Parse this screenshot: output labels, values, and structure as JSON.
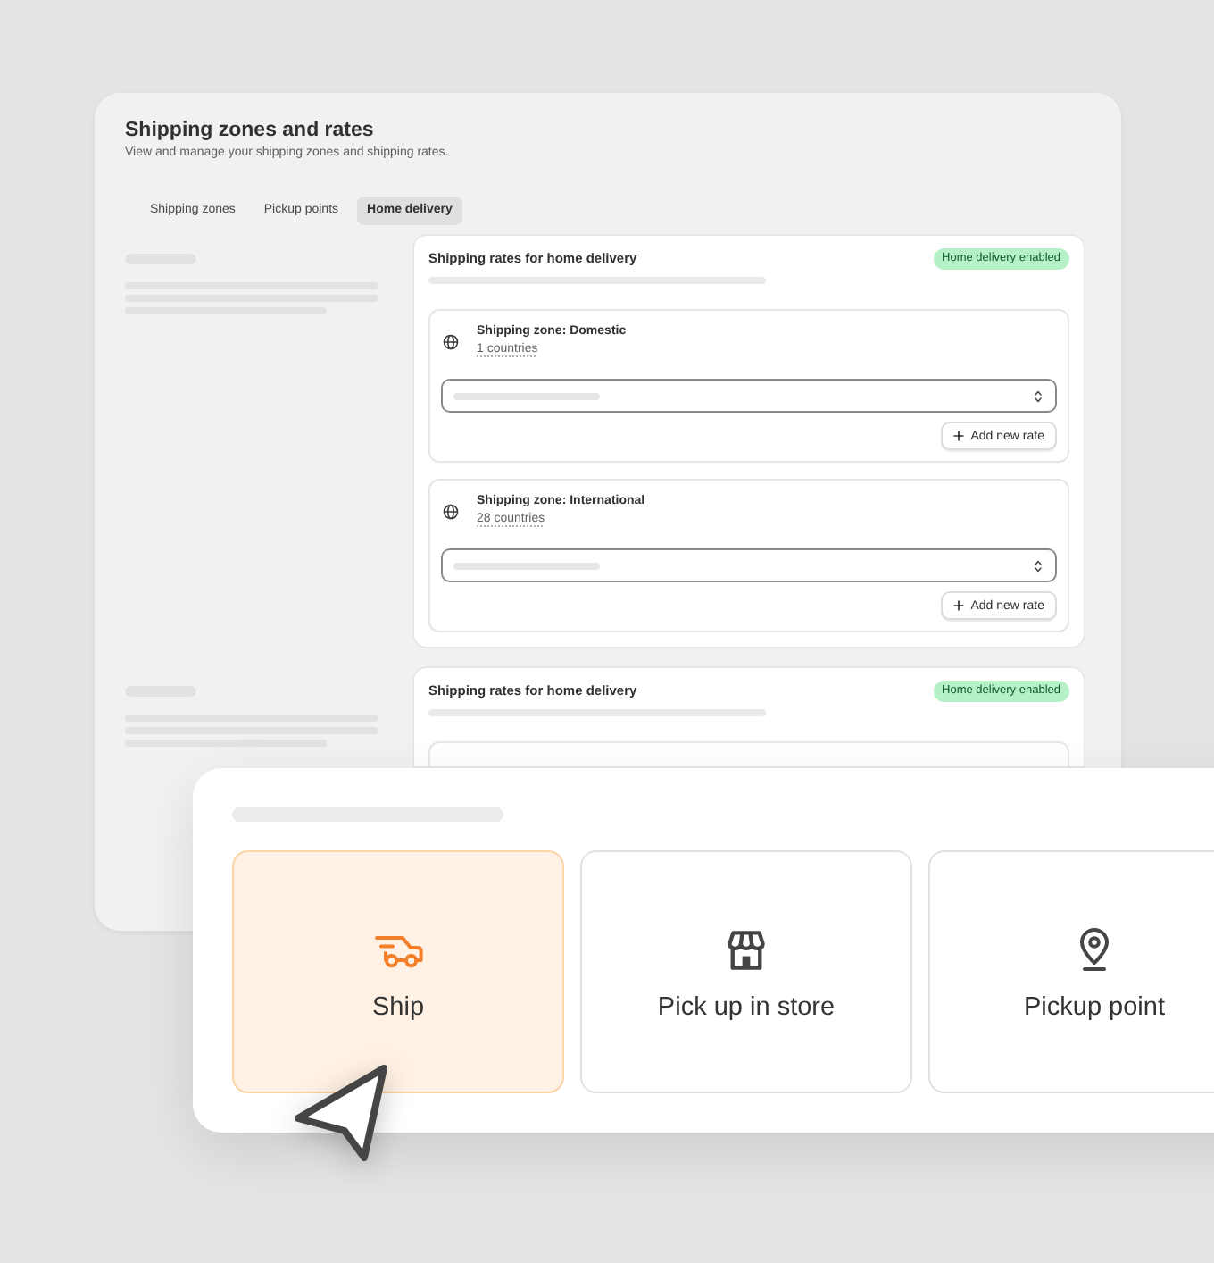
{
  "window": {
    "title": "Shipping zones and rates",
    "subtitle": "View and manage your shipping zones and shipping rates."
  },
  "tabs": [
    {
      "label": "Shipping zones",
      "selected": false
    },
    {
      "label": "Pickup points",
      "selected": false
    },
    {
      "label": "Home delivery",
      "selected": true
    }
  ],
  "sections": [
    {
      "title": "Shipping rates for home delivery",
      "badge": "Home delivery enabled",
      "zones": [
        {
          "name": "Shipping zone: Domestic",
          "countries": "1 countries",
          "action": "Add new rate"
        },
        {
          "name": "Shipping zone: International",
          "countries": "28 countries",
          "action": "Add new rate"
        }
      ]
    },
    {
      "title": "Shipping rates for home delivery",
      "badge": "Home delivery enabled"
    }
  ],
  "delivery_options": [
    {
      "label": "Ship",
      "kind": "ship",
      "selected": true
    },
    {
      "label": "Pick up in store",
      "kind": "store",
      "selected": false
    },
    {
      "label": "Pickup point",
      "kind": "pin",
      "selected": false
    }
  ]
}
